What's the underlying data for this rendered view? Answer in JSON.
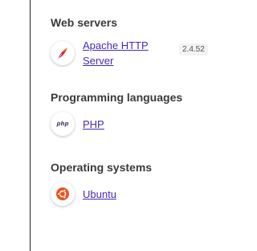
{
  "sections": [
    {
      "title": "Web servers",
      "items": [
        {
          "name": "Apache HTTP Server",
          "version": "2.4.52",
          "icon": "apache-feather-icon"
        }
      ]
    },
    {
      "title": "Programming languages",
      "items": [
        {
          "name": "PHP",
          "icon_text": "php",
          "icon": "php-icon"
        }
      ]
    },
    {
      "title": "Operating systems",
      "items": [
        {
          "name": "Ubuntu",
          "icon": "ubuntu-icon"
        }
      ]
    }
  ],
  "colors": {
    "link": "#4a2bb5",
    "ubuntu_orange": "#e95420",
    "apache_red": "#c8202a"
  }
}
